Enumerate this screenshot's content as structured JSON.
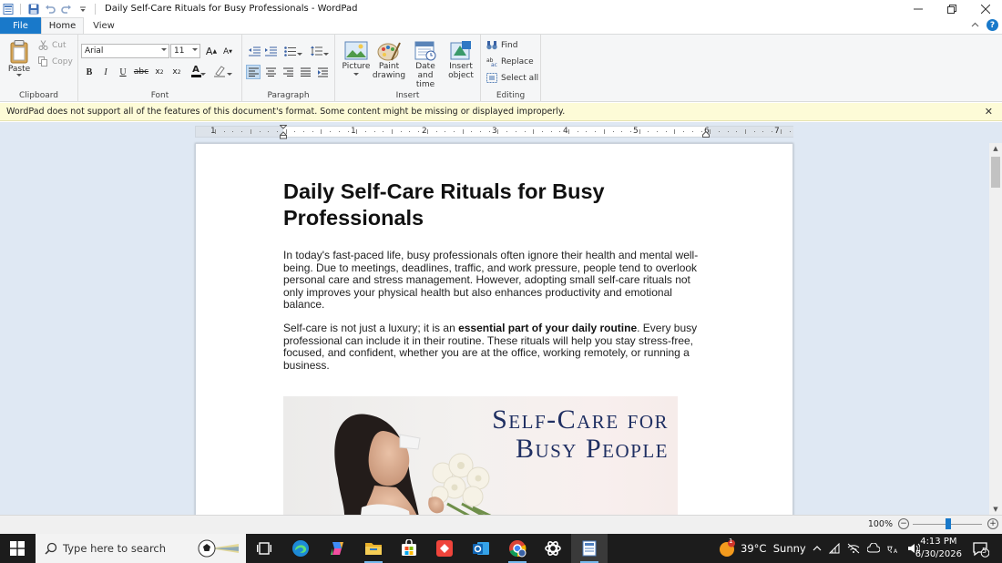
{
  "window": {
    "title": "Daily Self-Care Rituals for Busy Professionals - WordPad"
  },
  "tabs": {
    "file": "File",
    "home": "Home",
    "view": "View"
  },
  "ribbon": {
    "clipboard": {
      "label": "Clipboard",
      "paste": "Paste",
      "cut": "Cut",
      "copy": "Copy"
    },
    "font": {
      "label": "Font",
      "family": "Arial",
      "size": "11"
    },
    "paragraph": {
      "label": "Paragraph"
    },
    "insert": {
      "label": "Insert",
      "picture": "Picture",
      "paint_drawing": "Paint drawing",
      "date_time": "Date and time",
      "insert_object": "Insert object"
    },
    "editing": {
      "label": "Editing",
      "find": "Find",
      "replace": "Replace",
      "select_all": "Select all"
    }
  },
  "infobar": {
    "message": "WordPad does not support all of the features of this document's format. Some content might be missing or displayed improperly."
  },
  "ruler": {
    "numbers": [
      "1",
      "1",
      "2",
      "3",
      "4",
      "5",
      "6",
      "7"
    ]
  },
  "document": {
    "title": "Daily Self-Care Rituals for Busy Professionals",
    "paragraph1": "In today's fast-paced life, busy professionals often ignore their health and mental well-being. Due to meetings, deadlines, traffic, and work pressure, people tend to overlook personal care and stress management. However, adopting small self-care rituals not only improves your physical health but also enhances productivity and emotional balance.",
    "paragraph2_before": "Self-care is not just a luxury; it is an ",
    "paragraph2_bold": "essential part of your daily routine",
    "paragraph2_after": ". Every busy professional can include it in their routine. These rituals will help you stay stress-free, focused, and confident, whether you are at the office, working remotely, or running a business.",
    "image_text_line1": "Self-Care for",
    "image_text_line2": "Busy People"
  },
  "status": {
    "zoom": "100%"
  },
  "taskbar": {
    "search_placeholder": "Type here to search",
    "weather": "39°C  Sunny",
    "weather_badge": "1",
    "time": "4:13 PM",
    "date": "6/30/2026",
    "notifications": "5"
  },
  "colors": {
    "accent": "#1979ca",
    "infobar": "#fdfbd7",
    "workspace": "#dfe8f3",
    "taskbar": "#1c1c1c",
    "heading_image": "#1f2f62"
  }
}
